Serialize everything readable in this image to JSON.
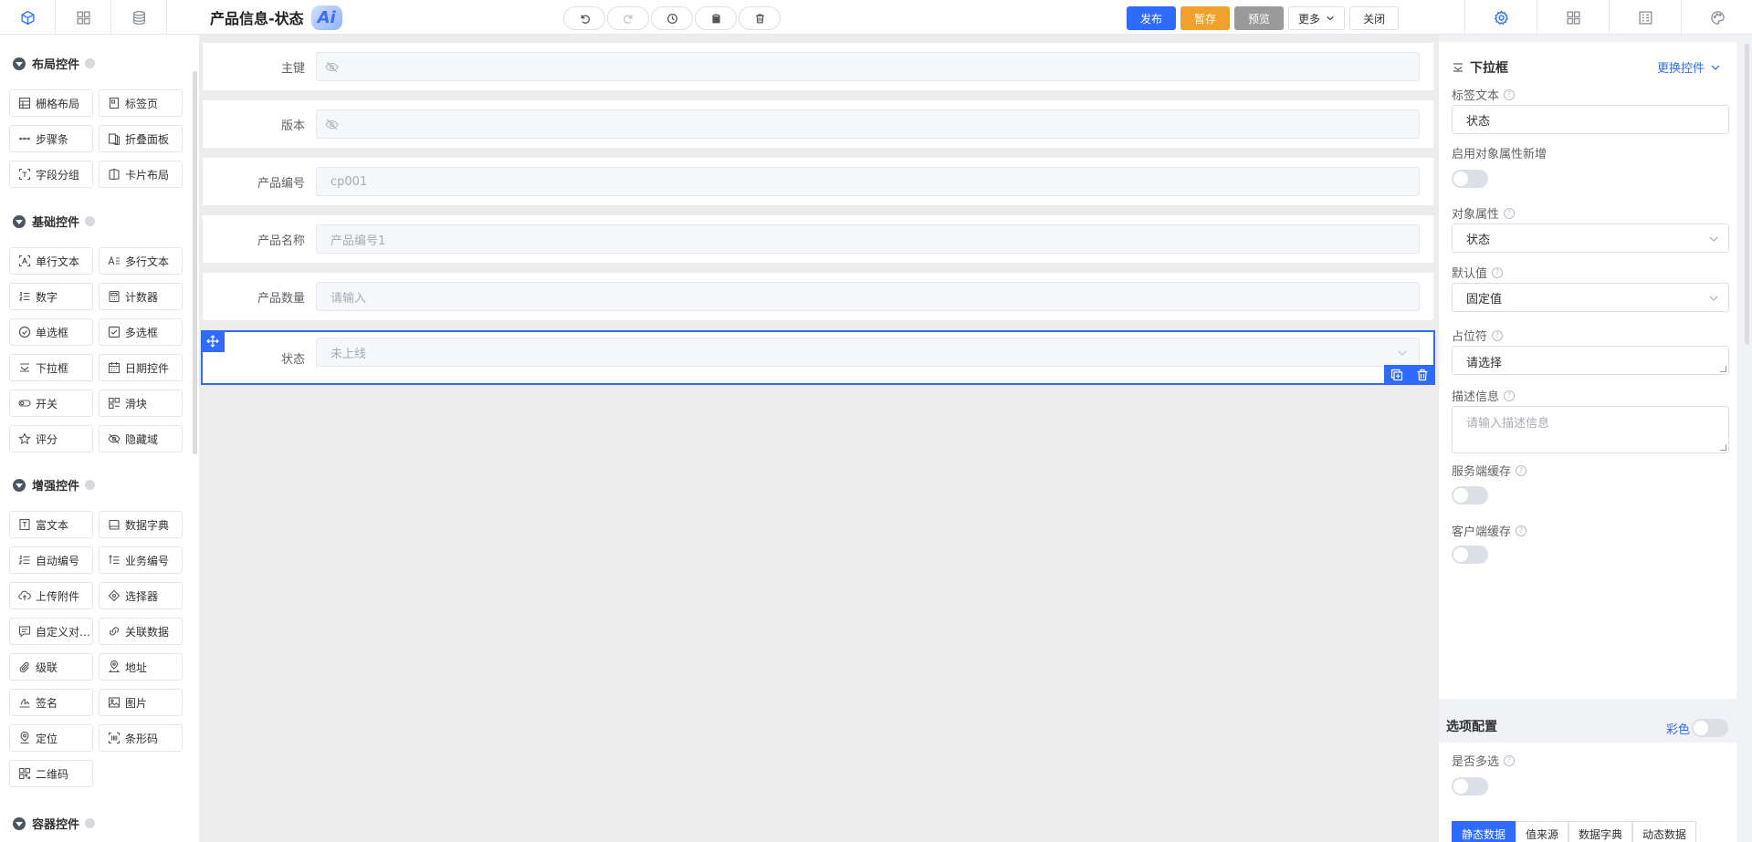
{
  "header": {
    "title": "产品信息-状态",
    "ai_badge": "Ai",
    "actions": {
      "publish": "发布",
      "draft": "暂存",
      "preview": "预览",
      "more": "更多",
      "close": "关闭"
    }
  },
  "left_tabs": [
    "cube-icon",
    "grid-icon",
    "database-icon"
  ],
  "right_tabs": [
    "gear-icon",
    "grid-icon",
    "form-icon",
    "palette-icon"
  ],
  "palette": {
    "layout": {
      "title": "布局控件",
      "items": [
        "栅格布局",
        "标签页",
        "步骤条",
        "折叠面板",
        "字段分组",
        "卡片布局"
      ]
    },
    "basic": {
      "title": "基础控件",
      "items": [
        "单行文本",
        "多行文本",
        "数字",
        "计数器",
        "单选框",
        "多选框",
        "下拉框",
        "日期控件",
        "开关",
        "滑块",
        "评分",
        "隐藏域"
      ]
    },
    "enhanced": {
      "title": "增强控件",
      "items": [
        "富文本",
        "数据字典",
        "自动编号",
        "业务编号",
        "上传附件",
        "选择器",
        "自定义对…",
        "关联数据",
        "级联",
        "地址",
        "签名",
        "图片",
        "定位",
        "条形码",
        "二维码"
      ]
    },
    "container": {
      "title": "容器控件"
    }
  },
  "form": {
    "rows": [
      {
        "label": "主键",
        "value": "",
        "hidden_icon": true
      },
      {
        "label": "版本",
        "value": "",
        "hidden_icon": true
      },
      {
        "label": "产品编号",
        "value": "cp001"
      },
      {
        "label": "产品名称",
        "value": "产品编号1"
      },
      {
        "label": "产品数量",
        "value": "请输入"
      },
      {
        "label": "状态",
        "value": "未上线",
        "selected": true
      }
    ]
  },
  "props": {
    "control_type": "下拉框",
    "replace_control": "更换控件",
    "label_text": {
      "label": "标签文本",
      "value": "状态"
    },
    "enable_object_attr_add": {
      "label": "启用对象属性新增",
      "on": false
    },
    "object_attr": {
      "label": "对象属性",
      "value": "状态"
    },
    "default_value": {
      "label": "默认值",
      "value": "固定值"
    },
    "placeholder": {
      "label": "占位符",
      "value": "请选择"
    },
    "description": {
      "label": "描述信息",
      "placeholder": "请输入描述信息"
    },
    "server_cache": {
      "label": "服务端缓存",
      "on": false
    },
    "client_cache": {
      "label": "客户端缓存",
      "on": false
    },
    "options": {
      "title": "选项配置",
      "color_label": "彩色",
      "multi": {
        "label": "是否多选",
        "on": false
      },
      "source_tabs": [
        "静态数据",
        "值来源",
        "数据字典",
        "动态数据"
      ],
      "active_source": "静态数据"
    }
  }
}
